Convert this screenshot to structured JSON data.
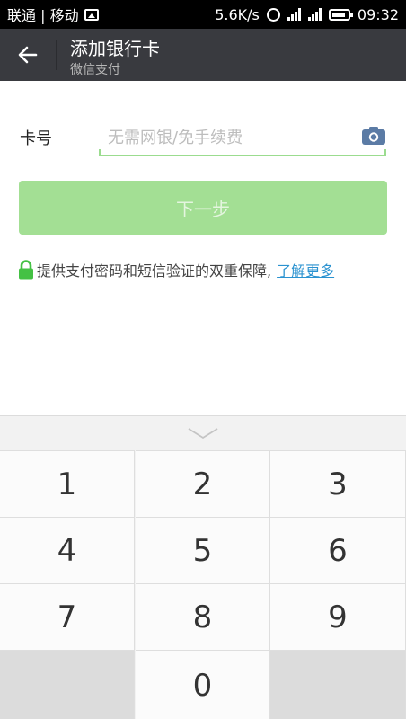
{
  "status_bar": {
    "carrier": "联通 | 移动",
    "speed": "5.6K/s",
    "time": "09:32",
    "icons": [
      "picture-icon",
      "alarm-icon",
      "signal-icon",
      "battery-icon"
    ]
  },
  "header": {
    "title": "添加银行卡",
    "subtitle": "微信支付",
    "back_icon": "arrow-left-icon"
  },
  "form": {
    "card_label": "卡号",
    "card_placeholder": "无需网银/免手续费",
    "card_value": "",
    "camera_icon": "camera-icon",
    "next_label": "下一步"
  },
  "security": {
    "lock_icon": "lock-icon",
    "text": "提供支付密码和短信验证的双重保障,",
    "link": "了解更多"
  },
  "keyboard": {
    "collapse_icon": "chevron-down-icon",
    "keys": [
      "1",
      "2",
      "3",
      "4",
      "5",
      "6",
      "7",
      "8",
      "9",
      "",
      "0",
      ""
    ]
  },
  "colors": {
    "header_bg": "#393a3f",
    "accent_green": "#a3df94",
    "lock_green": "#44c144",
    "link_blue": "#2a92d0",
    "camera_blue": "#5b7ba5"
  }
}
